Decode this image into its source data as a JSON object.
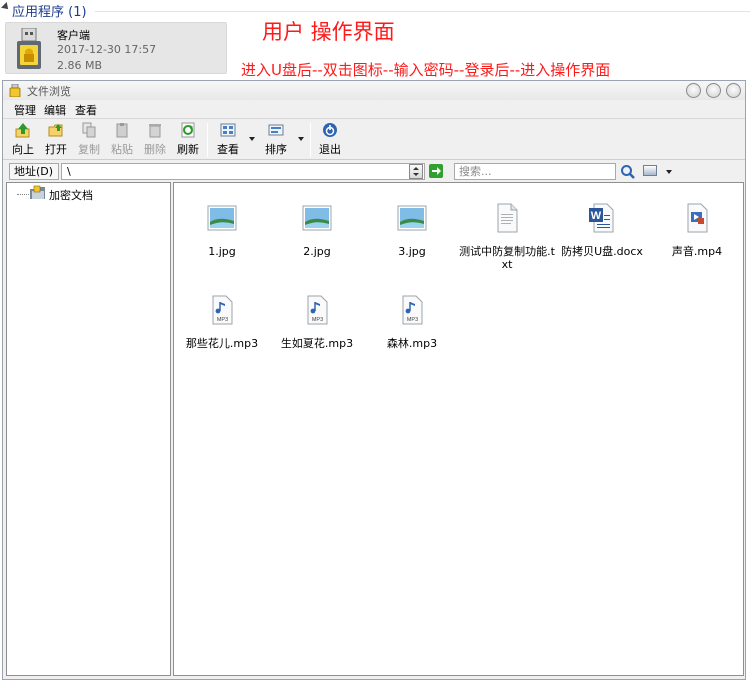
{
  "group": {
    "title": "应用程序 (1)"
  },
  "app_tile": {
    "name": "客户端",
    "date": "2017-12-30 17:57",
    "size": "2.86 MB"
  },
  "annotation": {
    "title": "用户 操作界面",
    "steps": "进入U盘后--双击图标--输入密码--登录后--进入操作界面"
  },
  "window": {
    "title": "文件浏览"
  },
  "menu": [
    "管理",
    "编辑",
    "查看"
  ],
  "toolbar": {
    "up": "向上",
    "open": "打开",
    "copy": "复制",
    "paste": "粘贴",
    "delete": "删除",
    "refresh": "刷新",
    "view": "查看",
    "sort": "排序",
    "exit": "退出"
  },
  "address": {
    "label": "地址(D)",
    "value": "\\",
    "search_placeholder": "搜索..."
  },
  "tree": {
    "root": "加密文档"
  },
  "files": [
    {
      "name": "1.jpg",
      "icon": "image-icon"
    },
    {
      "name": "2.jpg",
      "icon": "image-icon"
    },
    {
      "name": "3.jpg",
      "icon": "image-icon"
    },
    {
      "name": "测试中防复制功能.txt",
      "icon": "text-file-icon"
    },
    {
      "name": "防拷贝U盘.docx",
      "icon": "word-doc-icon"
    },
    {
      "name": "声音.mp4",
      "icon": "video-file-icon"
    },
    {
      "name": "那些花儿.mp3",
      "icon": "mp3-file-icon"
    },
    {
      "name": "生如夏花.mp3",
      "icon": "mp3-file-icon"
    },
    {
      "name": "森林.mp3",
      "icon": "mp3-file-icon"
    }
  ],
  "colors": {
    "annotation": "#ff1a1a",
    "group_title": "#1e3c8c",
    "accent_green": "#2fa12f"
  }
}
